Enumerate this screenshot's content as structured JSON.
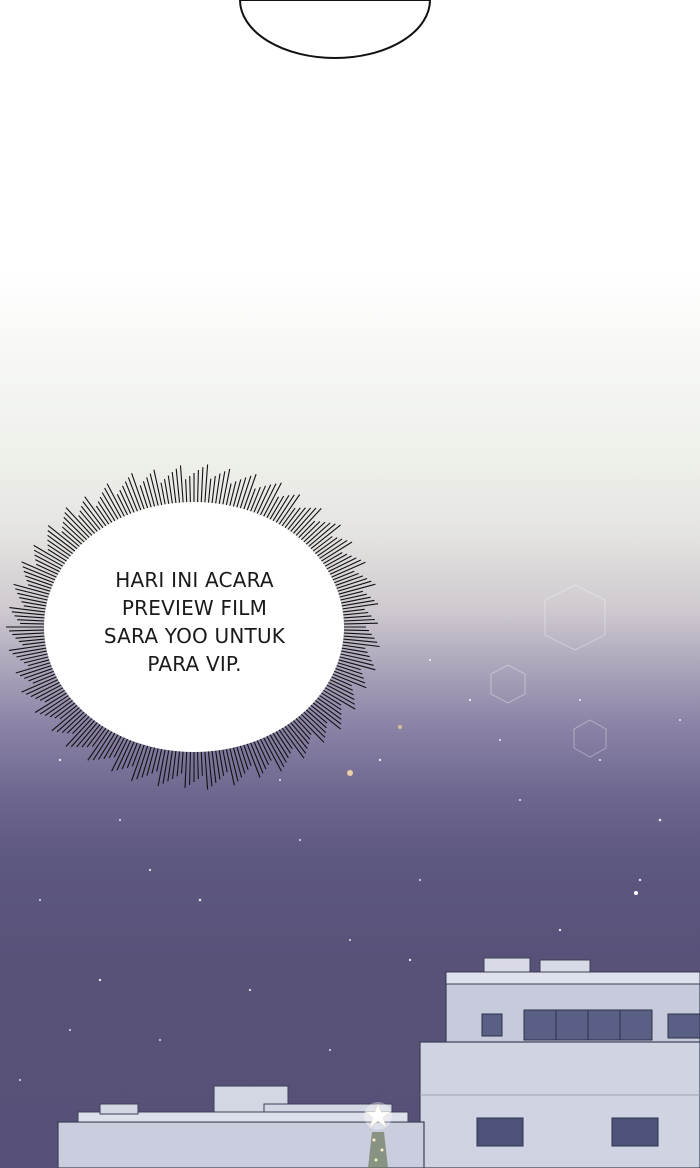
{
  "panel": {
    "speech_bubble": {
      "lines": [
        "HARI INI ACARA",
        "PREVIEW FILM",
        "SARA YOO UNTUK",
        "PARA VIP."
      ]
    }
  },
  "icons": [
    "top-speech-bubble-icon",
    "spiky-thought-bubble-icon",
    "star-decoration-icon",
    "building-icon"
  ],
  "colors": {
    "sky_top": "#ffffff",
    "sky_bottom": "#575078",
    "building": "#c9cdde",
    "ink": "#1a1a1a"
  }
}
